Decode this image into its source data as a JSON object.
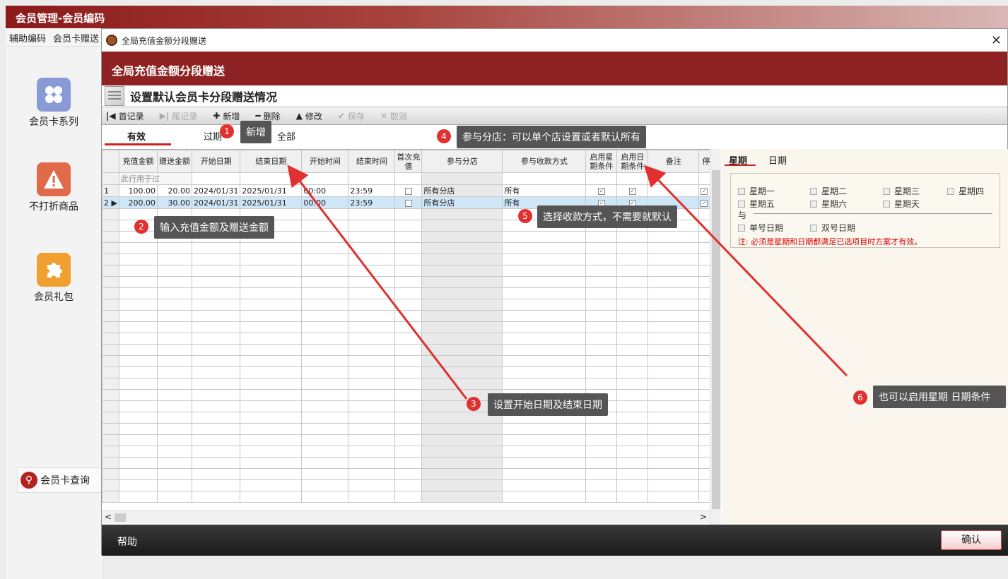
{
  "app": {
    "title": "会员管理-会员编码",
    "menu": [
      "辅助编码",
      "会员卡赠送"
    ],
    "side_items": [
      {
        "label": "会员卡系列",
        "icon": "grid-icon",
        "color": "#8a9ad6"
      },
      {
        "label": "不打折商品",
        "icon": "warning-icon",
        "color": "#e06a4a"
      },
      {
        "label": "会员礼包",
        "icon": "puzzle-icon",
        "color": "#f0a030"
      }
    ],
    "query_label": "会员卡查询"
  },
  "dialog": {
    "window_title": "全局充值金额分段赠送",
    "banner": "全局充值金额分段赠送",
    "subtitle": "设置默认会员卡分段赠送情况",
    "toolbar": {
      "first": "首记录",
      "last": "尾记录",
      "add": "新增",
      "delete": "删除",
      "edit": "修改",
      "save": "保存",
      "cancel": "取消"
    },
    "tabs": {
      "valid": "有效",
      "expired": "过期",
      "all": "全部"
    },
    "grid": {
      "headers": [
        "充值金额",
        "赠送金额",
        "开始日期",
        "结束日期",
        "开始时间",
        "结束时间",
        "首次充值",
        "参与分店",
        "参与收款方式",
        "启用星期条件",
        "启用日期条件",
        "备注",
        "停"
      ],
      "hint_row": "此行用于过",
      "rows": [
        {
          "idx": "1",
          "amount": "100.00",
          "gift": "20.00",
          "start_date": "2024/01/31",
          "end_date": "2025/01/31",
          "start_time": "00:00",
          "end_time": "23:59",
          "store": "所有分店",
          "payment": "所有"
        },
        {
          "idx": "2",
          "amount": "200.00",
          "gift": "30.00",
          "start_date": "2024/01/31",
          "end_date": "2025/01/31",
          "start_time": "00:00",
          "end_time": "23:59",
          "store": "所有分店",
          "payment": "所有"
        }
      ]
    },
    "right_panel": {
      "tab_week": "星期",
      "tab_date": "日期",
      "weekdays": [
        "星期一",
        "星期二",
        "星期三",
        "星期四",
        "星期五",
        "星期六",
        "星期天"
      ],
      "and_label": "与",
      "odd_day": "单号日期",
      "even_day": "双号日期",
      "note": "注: 必须是星期和日期都满足已选项目时方案才有效。"
    },
    "footer": {
      "help": "帮助",
      "ok": "确认"
    }
  },
  "annotations": [
    {
      "num": "1",
      "text": "新增"
    },
    {
      "num": "2",
      "text": "输入充值金额及赠送金额"
    },
    {
      "num": "3",
      "text": "设置开始日期及结束日期"
    },
    {
      "num": "4",
      "text": "参与分店：可以单个店设置或者默认所有"
    },
    {
      "num": "5",
      "text": "选择收款方式，不需要就默认"
    },
    {
      "num": "6",
      "text": "也可以启用星期 日期条件"
    }
  ]
}
